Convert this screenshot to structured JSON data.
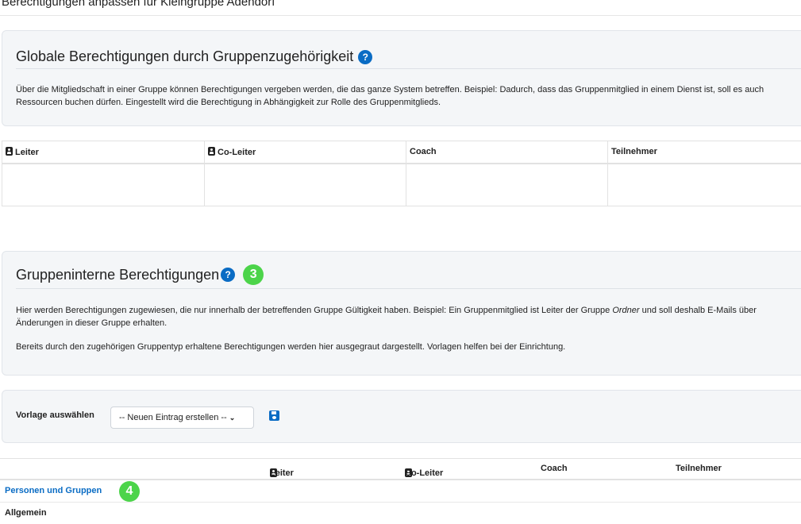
{
  "page_title": "Berechtigungen anpassen für Kleingruppe Adendorf",
  "global_section": {
    "heading": "Globale Berechtigungen durch Gruppenzugehörigkeit",
    "help_icon": "?",
    "description": "Über die Mitgliedschaft in einer Gruppe können Berechtigungen vergeben werden, die das ganze System betreffen. Beispiel: Dadurch, dass das Gruppenmitglied in einem Dienst ist, soll es auch Ressourcen buchen dürfen. Eingestellt wird die Berechtigung in Abhängigkeit zur Rolle des Gruppenmitglieds."
  },
  "global_table": {
    "columns": [
      "Leiter",
      "Co-Leiter",
      "Coach",
      "Teilnehmer"
    ]
  },
  "internal_section": {
    "heading": "Gruppeninterne Berechtigungen",
    "help_icon": "?",
    "step_badge": "3",
    "description_1_before": "Hier werden Berechtigungen zugewiesen, die nur innerhalb der betreffenden Gruppe Gültigkeit haben. Beispiel: Ein Gruppenmitglied ist Leiter der Gruppe ",
    "description_1_italic": "Ordner",
    "description_1_after": " und soll deshalb E-Mails über Änderungen in dieser Gruppe erhalten.",
    "description_2": "Bereits durch den zugehörigen Gruppentyp erhaltene Berechtigungen werden hier ausgegraut dargestellt. Vorlagen helfen bei der Einrichtung."
  },
  "template": {
    "label": "Vorlage auswählen",
    "selected": "-- Neuen Eintrag erstellen --",
    "save_icon": "save-icon"
  },
  "perm_table": {
    "columns": [
      "Leiter",
      "Co-Leiter",
      "Coach",
      "Teilnehmer"
    ],
    "rows": [
      {
        "label": "Personen und Gruppen",
        "step_badge": "4"
      },
      {
        "label": "Allgemein"
      }
    ]
  },
  "colors": {
    "accent": "#0a6cc4",
    "badge_green": "#4cd44a",
    "panel_bg": "#f4f6f8"
  }
}
